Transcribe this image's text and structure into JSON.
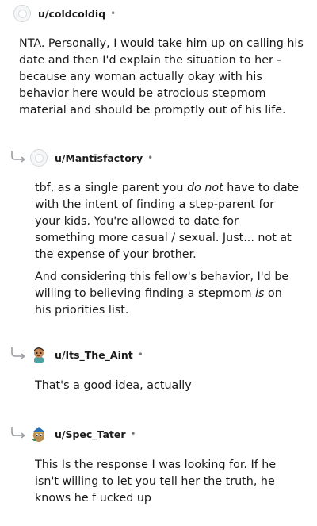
{
  "comments": [
    {
      "username": "u/coldcoldiq",
      "separator": "•",
      "avatar_icon": "default-avatar-icon",
      "paragraphs": [
        "NTA. Personally, I would take him up on calling his date and then I'd explain the situation to her - because any woman actually okay with his behavior here would be atrocious stepmom material and should be promptly out of his life."
      ]
    },
    {
      "username": "u/Mantisfactory",
      "separator": "•",
      "avatar_icon": "default-avatar-icon",
      "is_reply": true,
      "paragraphs": [
        {
          "before": "tbf, as a single parent you ",
          "em": "do not",
          "after": " have to date with the intent of finding a step-parent for your kids. You're allowed to date for something more casual / sexual. Just... not at the expense of your brother."
        },
        {
          "before": "And considering this fellow's behavior, I'd be willing to believing finding a stepmom ",
          "em": "is",
          "after": " on his priorities list."
        }
      ]
    },
    {
      "username": "u/Its_The_Aint",
      "separator": "•",
      "avatar_icon": "cartoon-character-avatar-icon",
      "is_reply": true,
      "paragraphs": [
        "That's a good idea, actually"
      ]
    },
    {
      "username": "u/Spec_Tater",
      "separator": "•",
      "avatar_icon": "potato-character-avatar-icon",
      "is_reply": true,
      "paragraphs": [
        "This Is the response I was looking for. If he isn't willing to let you tell her the truth, he knows he f ucked up"
      ]
    }
  ]
}
